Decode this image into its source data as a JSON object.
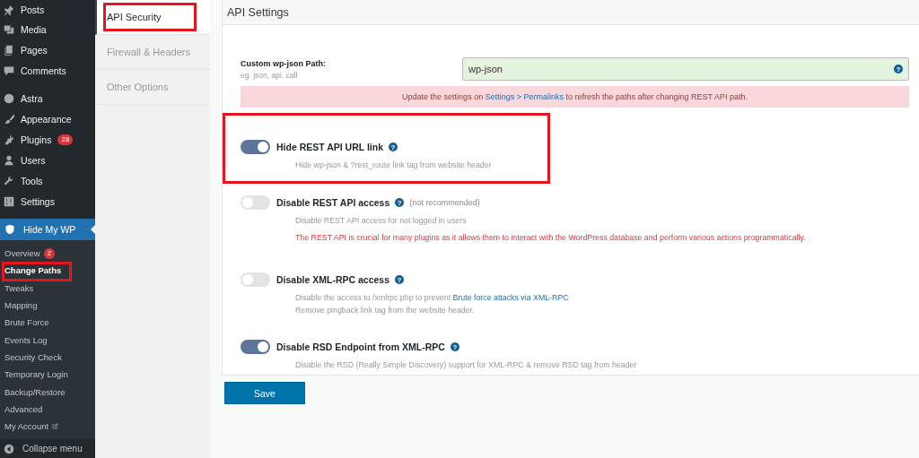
{
  "sidebar": {
    "item_groups": [
      [
        {
          "label": "Posts"
        },
        {
          "label": "Media"
        },
        {
          "label": "Pages"
        },
        {
          "label": "Comments"
        }
      ],
      [
        {
          "label": "Astra"
        },
        {
          "label": "Appearance"
        },
        {
          "label": "Plugins",
          "badge": "28"
        },
        {
          "label": "Users"
        },
        {
          "label": "Tools"
        },
        {
          "label": "Settings"
        }
      ]
    ],
    "current": {
      "label": "Hide My WP"
    },
    "submenu": [
      {
        "label": "Overview",
        "badge": "2",
        "selected": false,
        "highlighted": false,
        "external": false
      },
      {
        "label": "Change Paths",
        "selected": true,
        "highlighted": true,
        "external": false
      },
      {
        "label": "Tweaks",
        "selected": false,
        "highlighted": false,
        "external": false
      },
      {
        "label": "Mapping",
        "selected": false,
        "highlighted": false,
        "external": false
      },
      {
        "label": "Brute Force",
        "selected": false,
        "highlighted": false,
        "external": false
      },
      {
        "label": "Events Log",
        "selected": false,
        "highlighted": false,
        "external": false
      },
      {
        "label": "Security Check",
        "selected": false,
        "highlighted": false,
        "external": false
      },
      {
        "label": "Temporary Login",
        "selected": false,
        "highlighted": false,
        "external": false
      },
      {
        "label": "Backup/Restore",
        "selected": false,
        "highlighted": false,
        "external": false
      },
      {
        "label": "Advanced",
        "selected": false,
        "highlighted": false,
        "external": false
      },
      {
        "label": "My Account",
        "selected": false,
        "highlighted": false,
        "external": true
      }
    ],
    "collapse": "Collapse menu"
  },
  "tabs": [
    {
      "label": "API Security",
      "selected": true,
      "highlighted": true
    },
    {
      "label": "Firewall & Headers",
      "selected": false,
      "highlighted": false
    },
    {
      "label": "Other Options",
      "selected": false,
      "highlighted": false
    }
  ],
  "panel": {
    "title": "API Settings",
    "field": {
      "label": "Custom wp-json Path:",
      "hint": "eg. json, api, call",
      "value": "wp-json",
      "help": "?"
    },
    "notice": [
      {
        "text": "Update the settings on ",
        "link": false
      },
      {
        "text": "Settings > Permalinks",
        "link": true
      },
      {
        "text": " to refresh the paths after changing REST API path.",
        "link": false
      }
    ],
    "options": [
      {
        "title": "Hide REST API URL link",
        "help": "?",
        "on": true,
        "highlighted": true,
        "lines": [
          {
            "kind": "plain",
            "segments": [
              {
                "text": "Hide wp-json & ?rest_route link tag from website header",
                "link": false
              }
            ]
          }
        ]
      },
      {
        "title": "Disable REST API access",
        "help": "?",
        "note": "(not recommended)",
        "on": false,
        "highlighted": false,
        "lines": [
          {
            "kind": "plain",
            "segments": [
              {
                "text": "Disable REST API access for not logged in users",
                "link": false
              }
            ]
          },
          {
            "kind": "warning",
            "segments": [
              {
                "text": "The REST API is crucial for many plugins as it allows them to interact with the WordPress database and perform various actions programmatically.",
                "link": false
              }
            ]
          }
        ]
      },
      {
        "title": "Disable XML-RPC access",
        "help": "?",
        "on": false,
        "highlighted": false,
        "lines": [
          {
            "kind": "plain",
            "segments": [
              {
                "text": "Disable the access to /xmlrpc.php to prevent ",
                "link": false
              },
              {
                "text": "Brute force attacks via XML-RPC",
                "link": true
              }
            ]
          },
          {
            "kind": "plain",
            "segments": [
              {
                "text": "Remove pingback link tag from the website header.",
                "link": false
              }
            ]
          }
        ]
      },
      {
        "title": "Disable RSD Endpoint from XML-RPC",
        "help": "?",
        "on": true,
        "highlighted": false,
        "lines": [
          {
            "kind": "plain",
            "segments": [
              {
                "text": "Disable the RSD (Really Simple Discovery) support for XML-RPC & remove RSD tag from header",
                "link": false
              }
            ]
          }
        ]
      }
    ]
  },
  "save": "Save"
}
